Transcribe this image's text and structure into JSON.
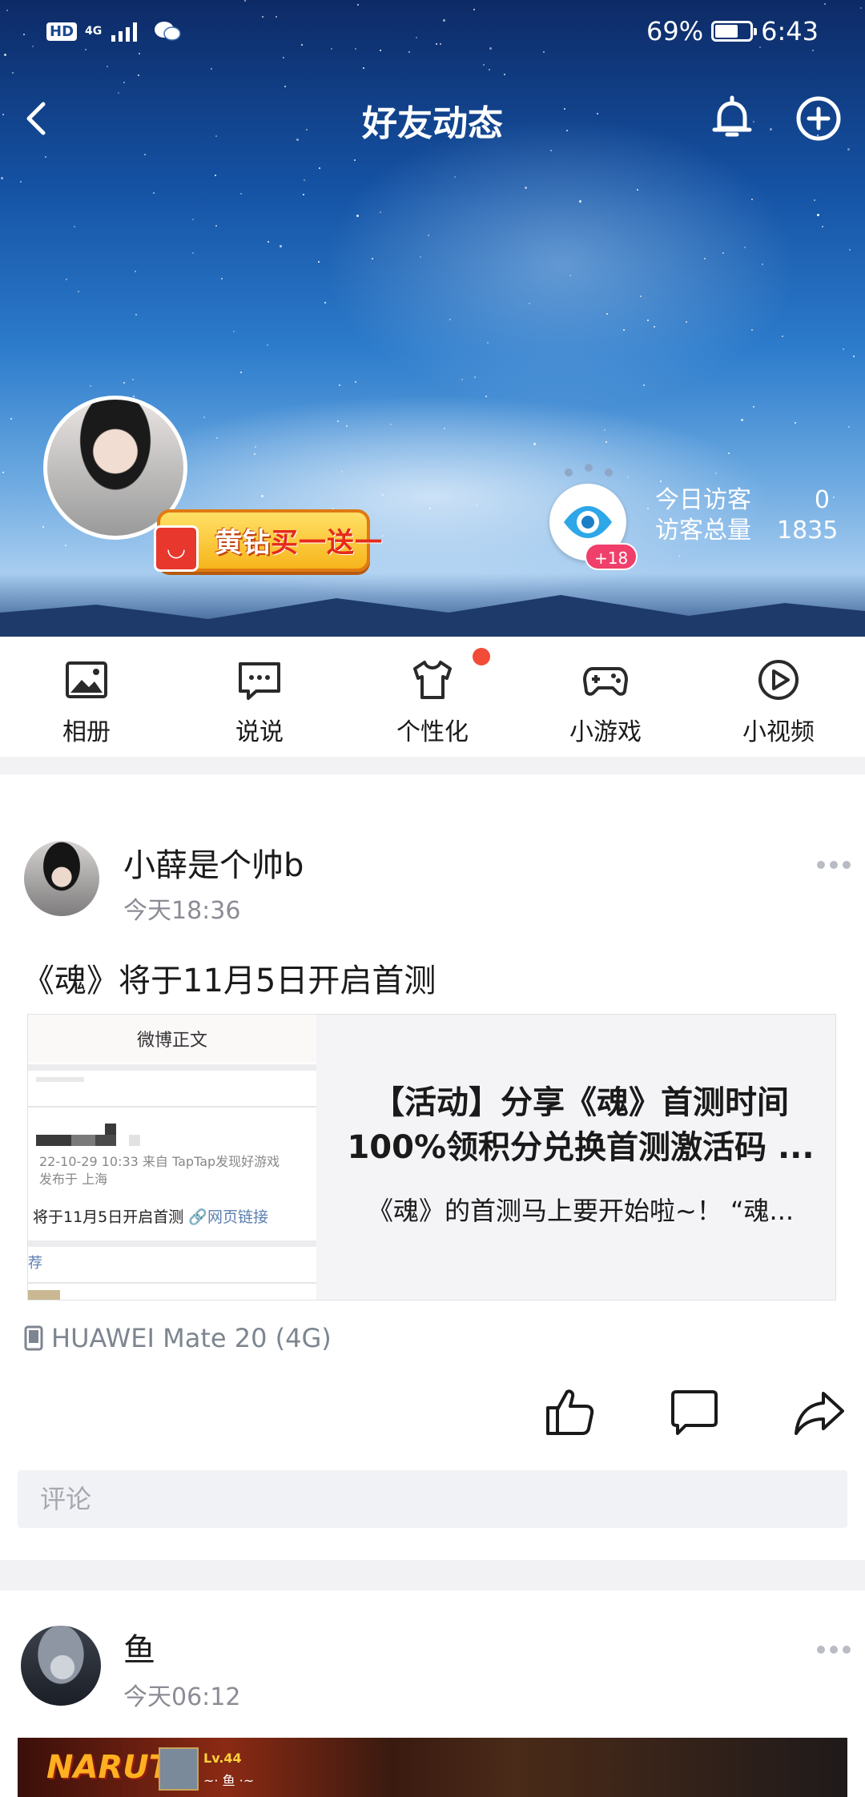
{
  "status_bar": {
    "hd": "HD",
    "network": "4G",
    "battery_text": "69%",
    "battery_level": 0.69,
    "time": "6:43"
  },
  "nav": {
    "title": "好友动态",
    "back_icon": "chevron-left-icon",
    "bell_icon": "bell-icon",
    "add_icon": "plus-circle-icon"
  },
  "profile": {
    "vip_banner": {
      "part1": "黄钻",
      "part2": "买一送一"
    },
    "visitor_badge": "+18",
    "visitors_today_label": "今日访客",
    "visitors_today": "0",
    "visitors_total_label": "访客总量",
    "visitors_total": "1835"
  },
  "quick_menu": [
    {
      "label": "相册",
      "icon": "photo-icon"
    },
    {
      "label": "说说",
      "icon": "message-icon"
    },
    {
      "label": "个性化",
      "icon": "tshirt-icon",
      "has_dot": true
    },
    {
      "label": "小游戏",
      "icon": "gamepad-icon"
    },
    {
      "label": "小视频",
      "icon": "play-circle-icon"
    }
  ],
  "posts": [
    {
      "author": "小薛是个帅b",
      "time": "今天18:36",
      "text": "《魂》将于11月5日开启首测",
      "link_card": {
        "thumb_header": "微博正文",
        "thumb_meta": "22-10-29 10:33  来自 TapTap发现好游戏",
        "thumb_meta2": "发布于 上海",
        "thumb_text": "将于11月5日开启首测",
        "thumb_link": "🔗网页链接",
        "thumb_rec": "荐",
        "title": "【活动】分享《魂》首测时间100%领积分兑换首测激活码 ...",
        "desc": "《魂》的首测马上要开始啦~！ “魂..."
      },
      "device": "HUAWEI Mate 20 (4G)",
      "comment_placeholder": "评论"
    },
    {
      "author": "鱼",
      "time": "今天06:12",
      "game_banner": {
        "logo": "NARUTO",
        "level": "Lv.44",
        "sub": "~· 鱼 ·~"
      }
    }
  ],
  "colors": {
    "accent_red": "#f24b38",
    "text_primary": "#1a1a1a",
    "text_secondary": "#8c8c96",
    "divider": "#f2f2f4"
  }
}
